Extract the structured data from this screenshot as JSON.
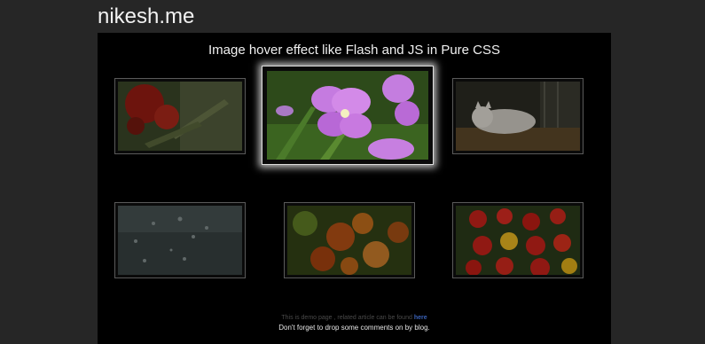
{
  "site": {
    "title": "nikesh.me"
  },
  "page": {
    "heading": "Image hover effect like Flash and JS in Pure CSS"
  },
  "gallery": {
    "images": [
      {
        "subject": "red bottlebrush flower",
        "hovered": false
      },
      {
        "subject": "purple orchid",
        "hovered": true
      },
      {
        "subject": "white cat sleeping",
        "hovered": false
      },
      {
        "subject": "water droplets",
        "hovered": false
      },
      {
        "subject": "orange flowers",
        "hovered": false
      },
      {
        "subject": "red and yellow berries",
        "hovered": false
      }
    ]
  },
  "footer": {
    "demo_note": "This is demo page , related article can be found",
    "link_text": "here",
    "comment_note": "Don't forget to drop some comments on by blog."
  }
}
